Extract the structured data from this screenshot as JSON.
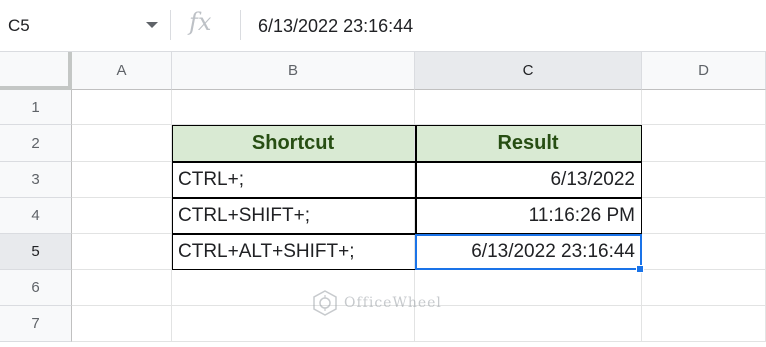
{
  "formula_bar": {
    "namebox": "C5",
    "fx_label": "fx",
    "value": "6/13/2022 23:16:44"
  },
  "columns": [
    "A",
    "B",
    "C",
    "D"
  ],
  "rows": [
    "1",
    "2",
    "3",
    "4",
    "5",
    "6",
    "7"
  ],
  "table": {
    "headers": [
      "Shortcut",
      "Result"
    ],
    "rows": [
      [
        "CTRL+;",
        "6/13/2022"
      ],
      [
        "CTRL+SHIFT+;",
        "11:16:26 PM"
      ],
      [
        "CTRL+ALT+SHIFT+;",
        "6/13/2022 23:16:44"
      ]
    ]
  },
  "watermark": "OfficeWheel",
  "colors": {
    "header_fill": "#d9ead3",
    "header_text": "#274e13",
    "selection": "#1a73e8"
  }
}
